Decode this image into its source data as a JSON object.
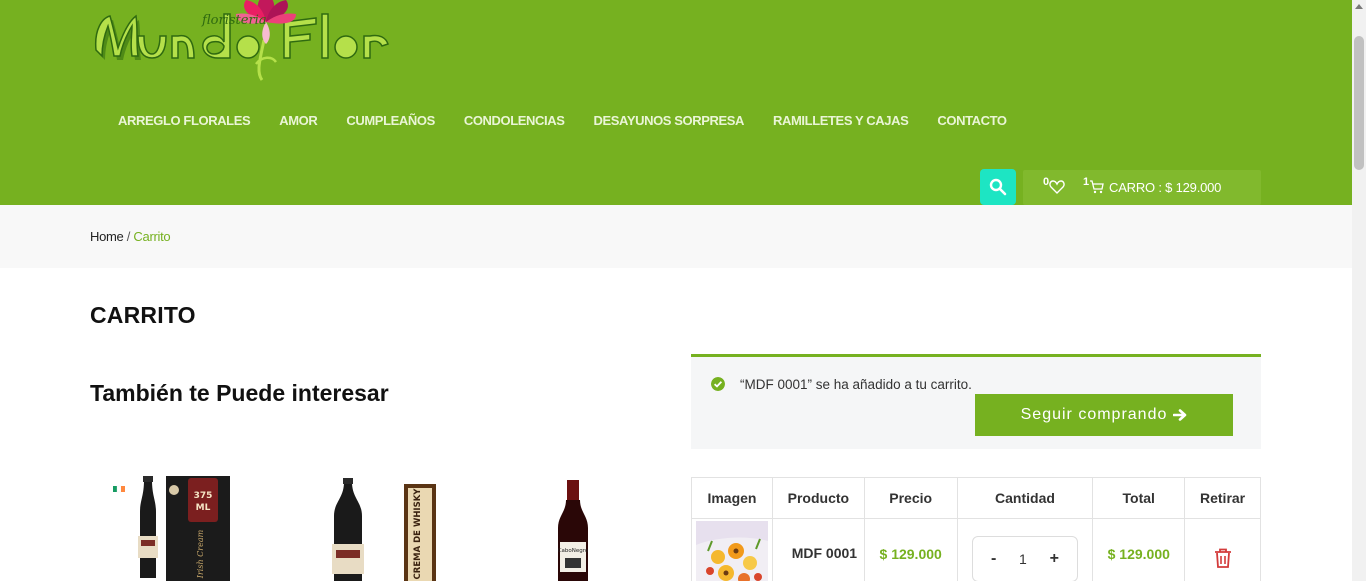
{
  "brand": {
    "small": "floristeria",
    "name": "Mundo Flor"
  },
  "nav": [
    "ARREGLO FLORALES",
    "AMOR",
    "CUMPLEAÑOS",
    "CONDOLENCIAS",
    "DESAYUNOS SORPRESA",
    "RAMILLETES Y CAJAS",
    "CONTACTO"
  ],
  "header": {
    "wishlist_count": "0",
    "cart_count": "1",
    "cart_label": "CARRO : $ 129.000"
  },
  "breadcrumb": {
    "home": "Home",
    "sep": " / ",
    "current": "Carrito"
  },
  "page_title": "CARRITO",
  "related": {
    "title": "También te Puede interesar",
    "products": [
      {
        "label_a": "375",
        "label_b": "ML",
        "label_c": "Irish Cream"
      },
      {
        "label_a": "CREMA DE WHISKY"
      },
      {
        "label_a": "CaboNegro"
      }
    ]
  },
  "notice": {
    "text": "“MDF 0001” se ha añadido a tu carrito.",
    "button": "Seguir comprando"
  },
  "cart": {
    "headers": [
      "Imagen",
      "Producto",
      "Precio",
      "Cantidad",
      "Total",
      "Retirar"
    ],
    "rows": [
      {
        "product": "MDF 0001",
        "price": "$ 129.000",
        "qty_minus": "-",
        "qty": "1",
        "qty_plus": "+",
        "total": "$ 129.000"
      }
    ]
  },
  "colors": {
    "brand_green": "#76b120",
    "search_button": "#1de5c3",
    "remove_icon": "#d33b3b"
  }
}
